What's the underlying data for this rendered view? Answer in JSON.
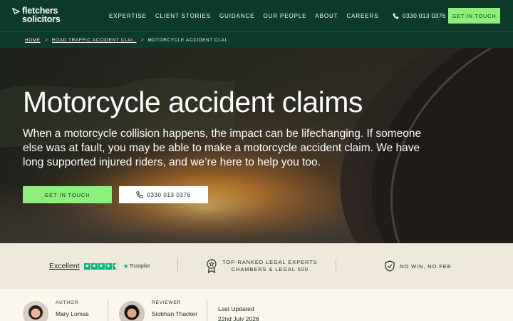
{
  "brand": {
    "line1": "fletchers",
    "line2": "solicitors"
  },
  "nav": [
    {
      "label": "EXPERTISE"
    },
    {
      "label": "CLIENT STORIES"
    },
    {
      "label": "GUIDANCE"
    },
    {
      "label": "OUR PEOPLE"
    },
    {
      "label": "ABOUT"
    },
    {
      "label": "CAREERS"
    }
  ],
  "header": {
    "phone": "0330 013 0376",
    "cta": "GET IN TOUCH"
  },
  "breadcrumb": {
    "home": "HOME",
    "parent": "ROAD TRAFFIC ACCIDENT CLAI..",
    "current": "MOTORCYCLE ACCIDENT CLAI..",
    "sep": ">"
  },
  "hero": {
    "title": "Motorcycle accident claims",
    "subtitle": "When a motorcycle collision happens, the impact can be lifechanging. If someone else was at fault, you may be able to make a motorcycle accident claim. We have long supported injured riders, and we’re here to help you too.",
    "cta_primary": "GET IN TOUCH",
    "cta_phone": "0330 013 0376"
  },
  "trust": {
    "rating_label": "Excellent",
    "stars": 4.5,
    "trustpilot": "Trustpilot",
    "award_line1": "TOP-RANKED LEGAL EXPERTS",
    "award_line2": "CHAMBERS & LEGAL 500",
    "no_win": "NO WIN, NO FEE"
  },
  "authors": {
    "author_label": "AUTHOR",
    "author_name": "Mary Lomas",
    "reviewer_label": "REVIEWER",
    "reviewer_name": "Siobhan Thacker",
    "updated_label": "Last Updated",
    "updated_date": "22nd July 2026"
  },
  "colors": {
    "dark_green": "#0e3a2b",
    "accent_green": "#8ef07a",
    "cream": "#fbf7ec",
    "trustpilot_green": "#00b67a"
  }
}
